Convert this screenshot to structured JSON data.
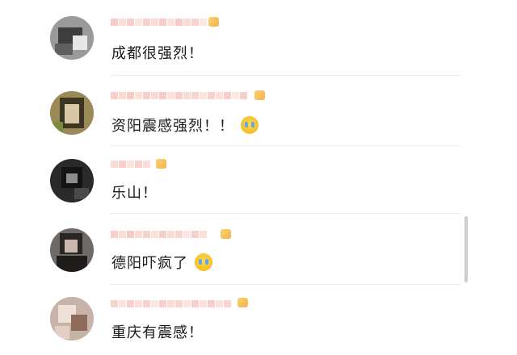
{
  "comments": [
    {
      "text": "成都很强烈！",
      "has_emoji": false
    },
    {
      "text": "资阳震感强烈！！",
      "has_emoji": true,
      "emoji_icon": "crying-face-icon"
    },
    {
      "text": "乐山！",
      "has_emoji": false
    },
    {
      "text": "德阳吓疯了",
      "has_emoji": true,
      "emoji_icon": "crying-face-icon"
    },
    {
      "text": "重庆有震感！",
      "has_emoji": false
    }
  ],
  "colors": {
    "text": "#1a1a1a",
    "divider": "#ececec",
    "badge": "#f4a62a",
    "emoji": "#f2b418"
  }
}
